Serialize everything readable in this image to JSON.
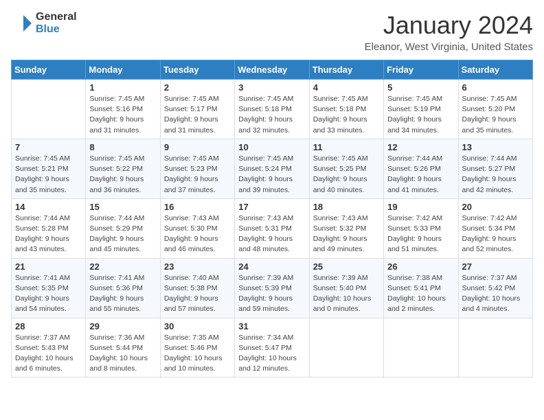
{
  "header": {
    "logo_general": "General",
    "logo_blue": "Blue",
    "month_title": "January 2024",
    "location": "Eleanor, West Virginia, United States"
  },
  "weekdays": [
    "Sunday",
    "Monday",
    "Tuesday",
    "Wednesday",
    "Thursday",
    "Friday",
    "Saturday"
  ],
  "weeks": [
    [
      {
        "day": "",
        "info": ""
      },
      {
        "day": "1",
        "info": "Sunrise: 7:45 AM\nSunset: 5:16 PM\nDaylight: 9 hours\nand 31 minutes."
      },
      {
        "day": "2",
        "info": "Sunrise: 7:45 AM\nSunset: 5:17 PM\nDaylight: 9 hours\nand 31 minutes."
      },
      {
        "day": "3",
        "info": "Sunrise: 7:45 AM\nSunset: 5:18 PM\nDaylight: 9 hours\nand 32 minutes."
      },
      {
        "day": "4",
        "info": "Sunrise: 7:45 AM\nSunset: 5:18 PM\nDaylight: 9 hours\nand 33 minutes."
      },
      {
        "day": "5",
        "info": "Sunrise: 7:45 AM\nSunset: 5:19 PM\nDaylight: 9 hours\nand 34 minutes."
      },
      {
        "day": "6",
        "info": "Sunrise: 7:45 AM\nSunset: 5:20 PM\nDaylight: 9 hours\nand 35 minutes."
      }
    ],
    [
      {
        "day": "7",
        "info": "Sunrise: 7:45 AM\nSunset: 5:21 PM\nDaylight: 9 hours\nand 35 minutes."
      },
      {
        "day": "8",
        "info": "Sunrise: 7:45 AM\nSunset: 5:22 PM\nDaylight: 9 hours\nand 36 minutes."
      },
      {
        "day": "9",
        "info": "Sunrise: 7:45 AM\nSunset: 5:23 PM\nDaylight: 9 hours\nand 37 minutes."
      },
      {
        "day": "10",
        "info": "Sunrise: 7:45 AM\nSunset: 5:24 PM\nDaylight: 9 hours\nand 39 minutes."
      },
      {
        "day": "11",
        "info": "Sunrise: 7:45 AM\nSunset: 5:25 PM\nDaylight: 9 hours\nand 40 minutes."
      },
      {
        "day": "12",
        "info": "Sunrise: 7:44 AM\nSunset: 5:26 PM\nDaylight: 9 hours\nand 41 minutes."
      },
      {
        "day": "13",
        "info": "Sunrise: 7:44 AM\nSunset: 5:27 PM\nDaylight: 9 hours\nand 42 minutes."
      }
    ],
    [
      {
        "day": "14",
        "info": "Sunrise: 7:44 AM\nSunset: 5:28 PM\nDaylight: 9 hours\nand 43 minutes."
      },
      {
        "day": "15",
        "info": "Sunrise: 7:44 AM\nSunset: 5:29 PM\nDaylight: 9 hours\nand 45 minutes."
      },
      {
        "day": "16",
        "info": "Sunrise: 7:43 AM\nSunset: 5:30 PM\nDaylight: 9 hours\nand 46 minutes."
      },
      {
        "day": "17",
        "info": "Sunrise: 7:43 AM\nSunset: 5:31 PM\nDaylight: 9 hours\nand 48 minutes."
      },
      {
        "day": "18",
        "info": "Sunrise: 7:43 AM\nSunset: 5:32 PM\nDaylight: 9 hours\nand 49 minutes."
      },
      {
        "day": "19",
        "info": "Sunrise: 7:42 AM\nSunset: 5:33 PM\nDaylight: 9 hours\nand 51 minutes."
      },
      {
        "day": "20",
        "info": "Sunrise: 7:42 AM\nSunset: 5:34 PM\nDaylight: 9 hours\nand 52 minutes."
      }
    ],
    [
      {
        "day": "21",
        "info": "Sunrise: 7:41 AM\nSunset: 5:35 PM\nDaylight: 9 hours\nand 54 minutes."
      },
      {
        "day": "22",
        "info": "Sunrise: 7:41 AM\nSunset: 5:36 PM\nDaylight: 9 hours\nand 55 minutes."
      },
      {
        "day": "23",
        "info": "Sunrise: 7:40 AM\nSunset: 5:38 PM\nDaylight: 9 hours\nand 57 minutes."
      },
      {
        "day": "24",
        "info": "Sunrise: 7:39 AM\nSunset: 5:39 PM\nDaylight: 9 hours\nand 59 minutes."
      },
      {
        "day": "25",
        "info": "Sunrise: 7:39 AM\nSunset: 5:40 PM\nDaylight: 10 hours\nand 0 minutes."
      },
      {
        "day": "26",
        "info": "Sunrise: 7:38 AM\nSunset: 5:41 PM\nDaylight: 10 hours\nand 2 minutes."
      },
      {
        "day": "27",
        "info": "Sunrise: 7:37 AM\nSunset: 5:42 PM\nDaylight: 10 hours\nand 4 minutes."
      }
    ],
    [
      {
        "day": "28",
        "info": "Sunrise: 7:37 AM\nSunset: 5:43 PM\nDaylight: 10 hours\nand 6 minutes."
      },
      {
        "day": "29",
        "info": "Sunrise: 7:36 AM\nSunset: 5:44 PM\nDaylight: 10 hours\nand 8 minutes."
      },
      {
        "day": "30",
        "info": "Sunrise: 7:35 AM\nSunset: 5:46 PM\nDaylight: 10 hours\nand 10 minutes."
      },
      {
        "day": "31",
        "info": "Sunrise: 7:34 AM\nSunset: 5:47 PM\nDaylight: 10 hours\nand 12 minutes."
      },
      {
        "day": "",
        "info": ""
      },
      {
        "day": "",
        "info": ""
      },
      {
        "day": "",
        "info": ""
      }
    ]
  ]
}
